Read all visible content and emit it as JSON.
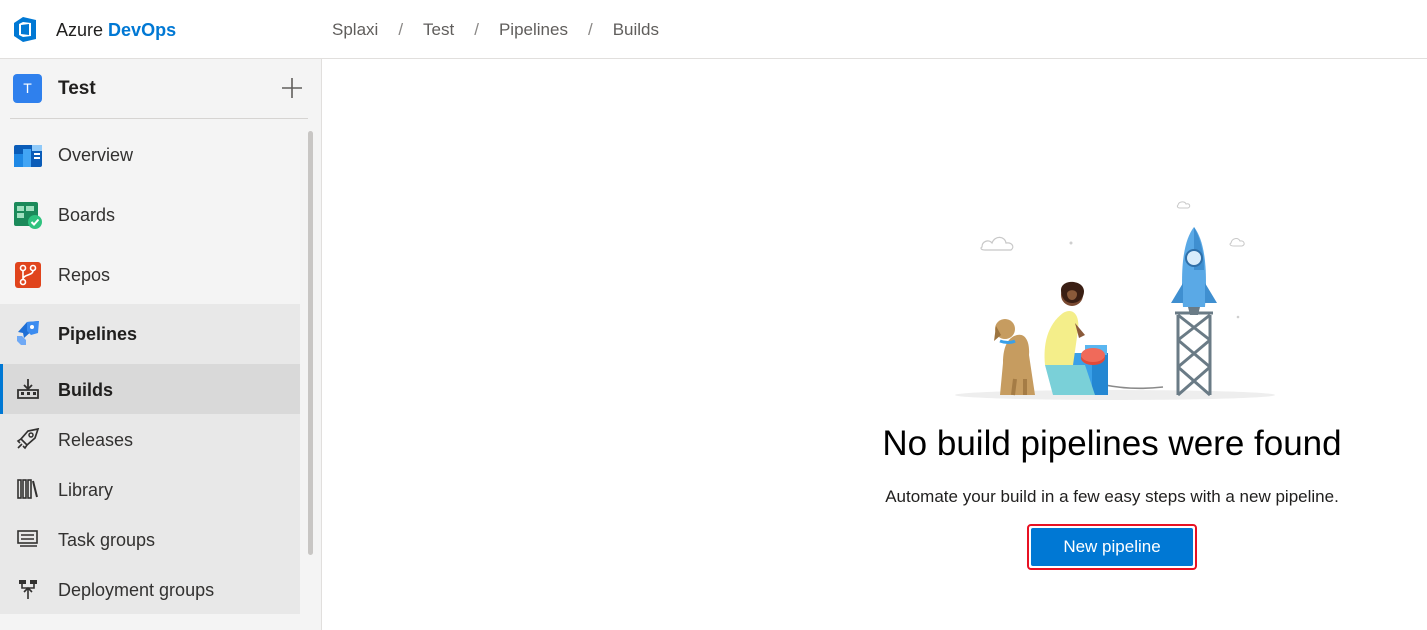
{
  "header": {
    "brand_prefix": "Azure",
    "brand_strong": "DevOps",
    "breadcrumbs": [
      "Splaxi",
      "Test",
      "Pipelines",
      "Builds"
    ],
    "separator": "/"
  },
  "sidebar": {
    "project_initial": "T",
    "project_name": "Test",
    "items": [
      {
        "label": "Overview",
        "icon": "overview-icon"
      },
      {
        "label": "Boards",
        "icon": "boards-icon"
      },
      {
        "label": "Repos",
        "icon": "repos-icon"
      },
      {
        "label": "Pipelines",
        "icon": "pipelines-icon"
      }
    ],
    "pipeline_subitems": [
      {
        "label": "Builds",
        "icon": "builds-icon",
        "selected": true
      },
      {
        "label": "Releases",
        "icon": "releases-icon"
      },
      {
        "label": "Library",
        "icon": "library-icon"
      },
      {
        "label": "Task groups",
        "icon": "task-groups-icon"
      },
      {
        "label": "Deployment groups",
        "icon": "deployment-groups-icon"
      }
    ]
  },
  "main": {
    "empty_title": "No build pipelines were found",
    "empty_description": "Automate your build in a few easy steps with a new pipeline.",
    "new_pipeline_label": "New pipeline"
  },
  "colors": {
    "accent": "#0078d4",
    "sidebar_bg": "#f4f4f4",
    "selected_bg": "#d9d9d9",
    "highlight_border": "#e81123"
  }
}
